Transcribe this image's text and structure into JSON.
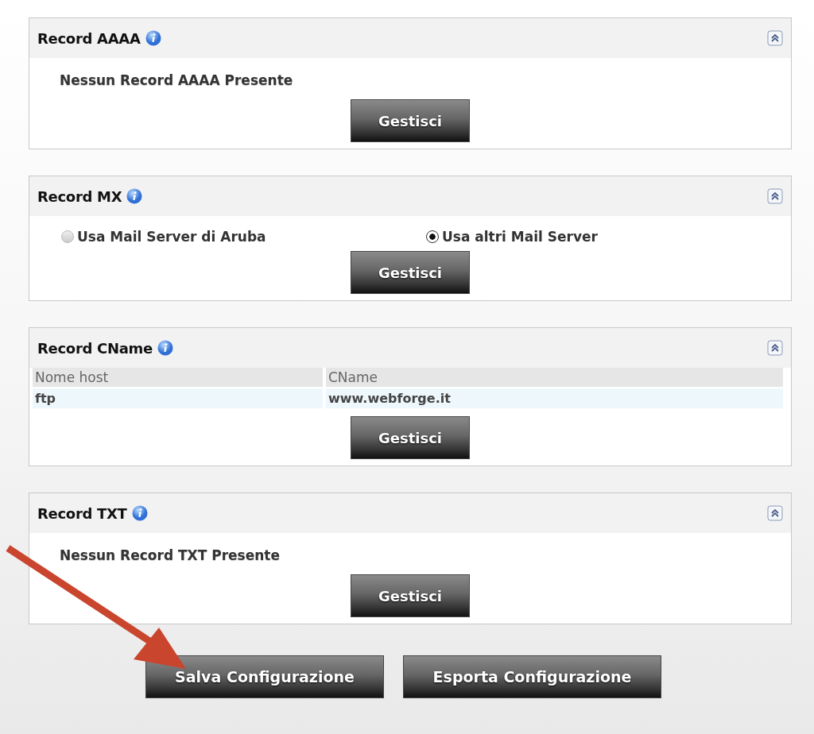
{
  "sections": [
    {
      "title": "Record AAAA",
      "kind": "message",
      "message": "Nessun Record AAAA Presente",
      "button": "Gestisci"
    },
    {
      "title": "Record MX",
      "kind": "radio",
      "options": [
        {
          "label": "Usa Mail Server di Aruba",
          "selected": false
        },
        {
          "label": "Usa altri Mail Server",
          "selected": true
        }
      ],
      "button": "Gestisci"
    },
    {
      "title": "Record CName",
      "kind": "table",
      "columns": [
        "Nome host",
        "CName"
      ],
      "rows": [
        [
          "ftp",
          "www.webforge.it"
        ]
      ],
      "button": "Gestisci"
    },
    {
      "title": "Record TXT",
      "kind": "message",
      "message": "Nessun Record TXT Presente",
      "button": "Gestisci"
    }
  ],
  "actions": [
    "Salva Configurazione",
    "Esporta Configurazione"
  ]
}
